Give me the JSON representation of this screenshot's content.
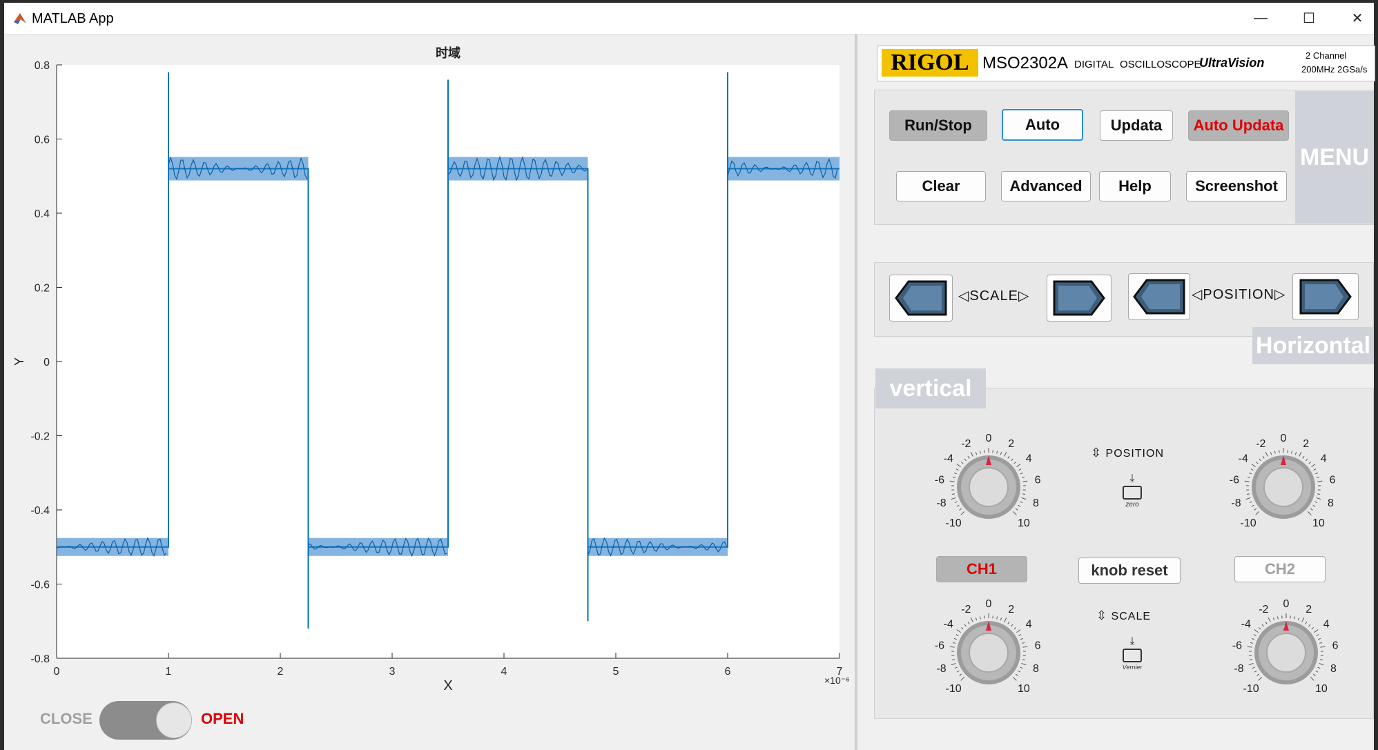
{
  "window": {
    "title": "MATLAB App",
    "minimize": "—",
    "maximize": "☐",
    "close": "✕"
  },
  "plot": {
    "title": "时域",
    "xlabel": "X",
    "ylabel": "Y",
    "x_exponent": "×10⁻⁶",
    "x_ticks": [
      "0",
      "1",
      "2",
      "3",
      "4",
      "5",
      "6",
      "7"
    ],
    "y_ticks": [
      "0.8",
      "0.6",
      "0.4",
      "0.2",
      "0",
      "-0.2",
      "-0.4",
      "-0.6",
      "-0.8"
    ],
    "line_color": "#0072bd"
  },
  "chart_data": {
    "type": "line",
    "title": "时域",
    "xlabel": "X",
    "ylabel": "Y",
    "xlim": [
      0,
      7e-06
    ],
    "ylim": [
      -0.8,
      0.8
    ],
    "grid": false,
    "series": [
      {
        "x": [
          0,
          1e-06,
          1e-06,
          2.25e-06,
          2.25e-06,
          3.5e-06,
          3.5e-06,
          4.75e-06,
          4.75e-06,
          6e-06,
          6e-06,
          7e-06
        ],
        "y": [
          -0.5,
          -0.5,
          0.52,
          0.52,
          -0.5,
          -0.5,
          0.52,
          0.52,
          -0.5,
          -0.5,
          0.52,
          0.52
        ],
        "spikes": [
          {
            "x": 1e-06,
            "y": 0.78
          },
          {
            "x": 2.25e-06,
            "y": -0.72
          },
          {
            "x": 3.5e-06,
            "y": 0.76
          },
          {
            "x": 4.75e-06,
            "y": -0.7
          },
          {
            "x": 6e-06,
            "y": 0.78
          }
        ]
      }
    ]
  },
  "toggle": {
    "off_label": "CLOSE",
    "on_label": "OPEN",
    "state": "OPEN"
  },
  "header": {
    "brand": "RIGOL",
    "model": "MSO2302A",
    "desc1": "DIGITAL ",
    "desc2": "OSCILLOSCOPE",
    "ultra": "UltraVision",
    "channels": "2 Channel",
    "spec": "200MHz  2GSa/s"
  },
  "menu": {
    "tab": "MENU",
    "buttons": {
      "run_stop": "Run/Stop",
      "auto": "Auto",
      "updata": "Updata",
      "auto_updata": "Auto Updata",
      "clear": "Clear",
      "advanced": "Advanced",
      "help": "Help",
      "screenshot": "Screenshot"
    }
  },
  "horizontal": {
    "tab": "Horizontal",
    "scale_label": "SCALE",
    "position_label": "POSITION"
  },
  "vertical": {
    "tab": "vertical",
    "position_label": "POSITION",
    "scale_label": "SCALE",
    "zero_label": "zero",
    "vernier_label": "Vernier",
    "ch1": "CH1",
    "ch2": "CH2",
    "knob_reset": "knob reset",
    "dial_ticks": [
      "-10",
      "-8",
      "-6",
      "-4",
      "-2",
      "0",
      "2",
      "4",
      "6",
      "8",
      "10"
    ]
  },
  "colors": {
    "accent_red": "#e00000",
    "plot_blue": "#0072bd",
    "panel_grey": "#e8e8e8",
    "tab_grey": "#cfd2d8"
  }
}
